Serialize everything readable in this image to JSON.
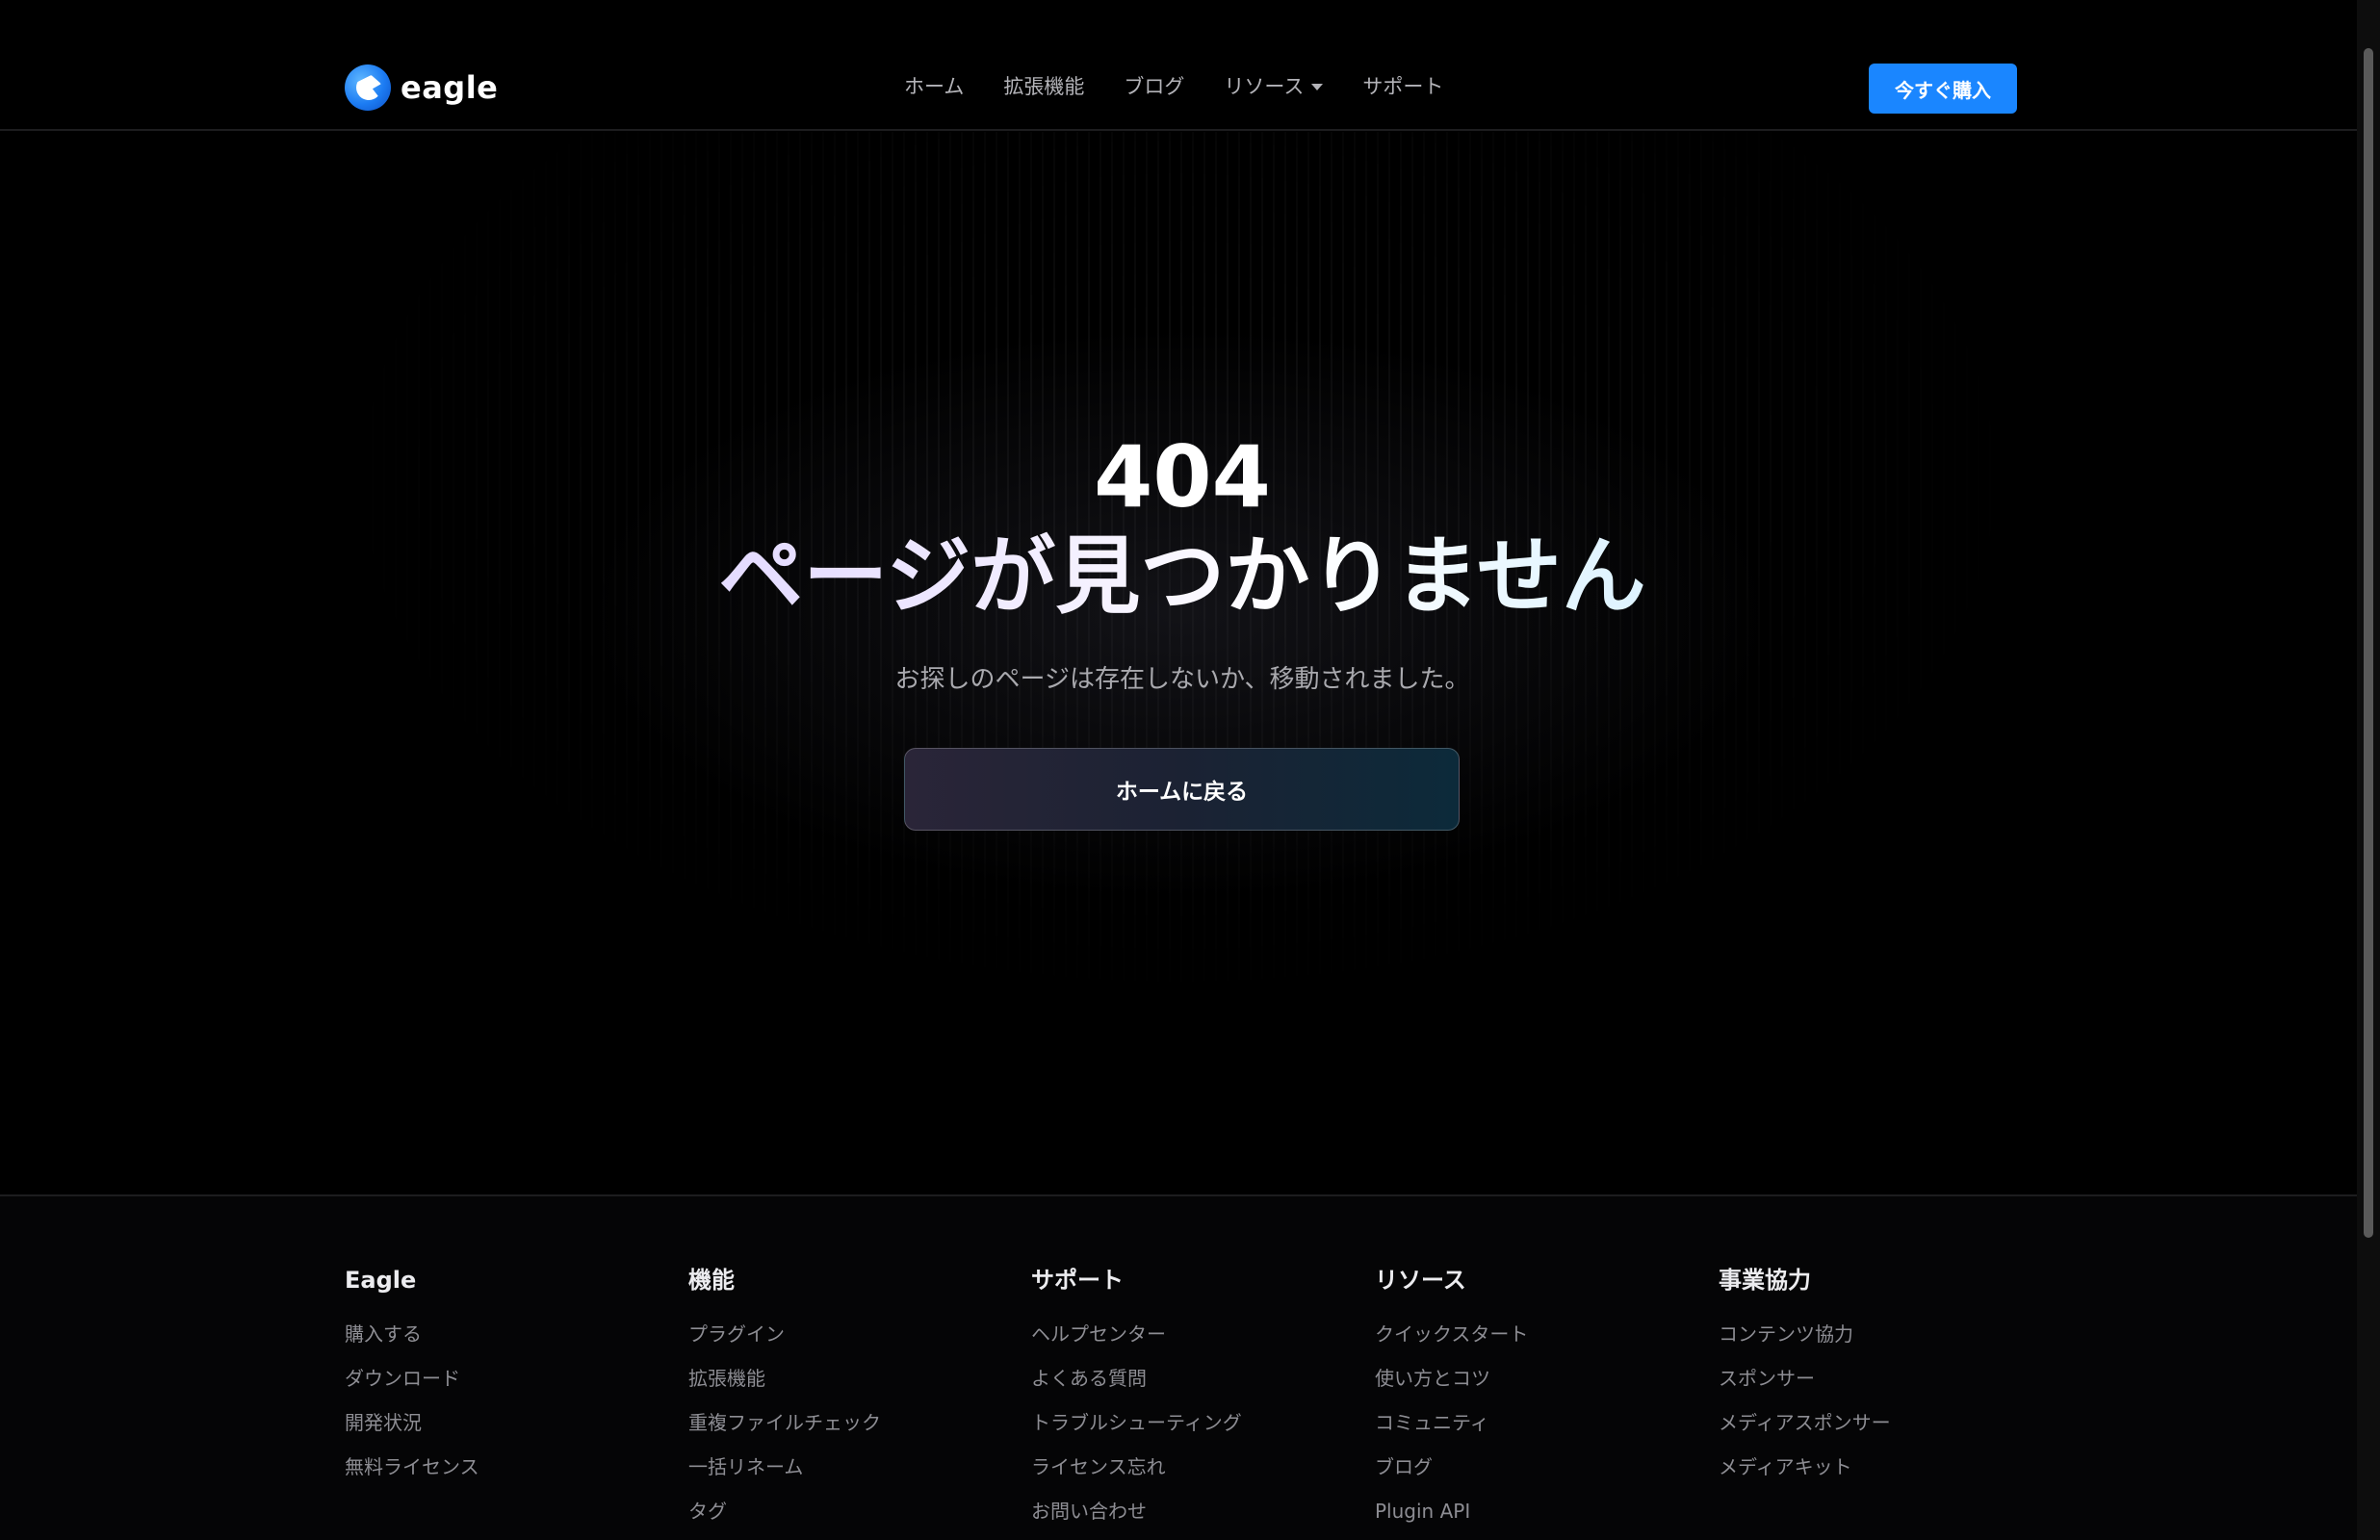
{
  "header": {
    "brand_name": "eagle",
    "nav": [
      "ホーム",
      "拡張機能",
      "ブログ",
      "リソース",
      "サポート"
    ],
    "buy_label": "今すぐ購入"
  },
  "hero": {
    "code": "404",
    "title": "ページが見つかりません",
    "description": "お探しのページは存在しないか、移動されました。",
    "home_button": "ホームに戻る"
  },
  "footer": {
    "columns": [
      {
        "heading": "Eagle",
        "links": [
          "購入する",
          "ダウンロード",
          "開発状況",
          "無料ライセンス"
        ]
      },
      {
        "heading": "機能",
        "links": [
          "プラグイン",
          "拡張機能",
          "重複ファイルチェック",
          "一括リネーム",
          "タグ"
        ]
      },
      {
        "heading": "サポート",
        "links": [
          "ヘルプセンター",
          "よくある質問",
          "トラブルシューティング",
          "ライセンス忘れ",
          "お問い合わせ"
        ]
      },
      {
        "heading": "リソース",
        "links": [
          "クイックスタート",
          "使い方とコツ",
          "コミュニティ",
          "ブログ",
          "Plugin API"
        ]
      },
      {
        "heading": "事業協力",
        "links": [
          "コンテンツ協力",
          "スポンサー",
          "メディアスポンサー",
          "メディアキット"
        ]
      }
    ]
  },
  "colors": {
    "background": "#000000",
    "accent": "#1a86ff",
    "title_gradient_start": "#c9b8ff",
    "title_gradient_end": "#9fe0ff"
  }
}
